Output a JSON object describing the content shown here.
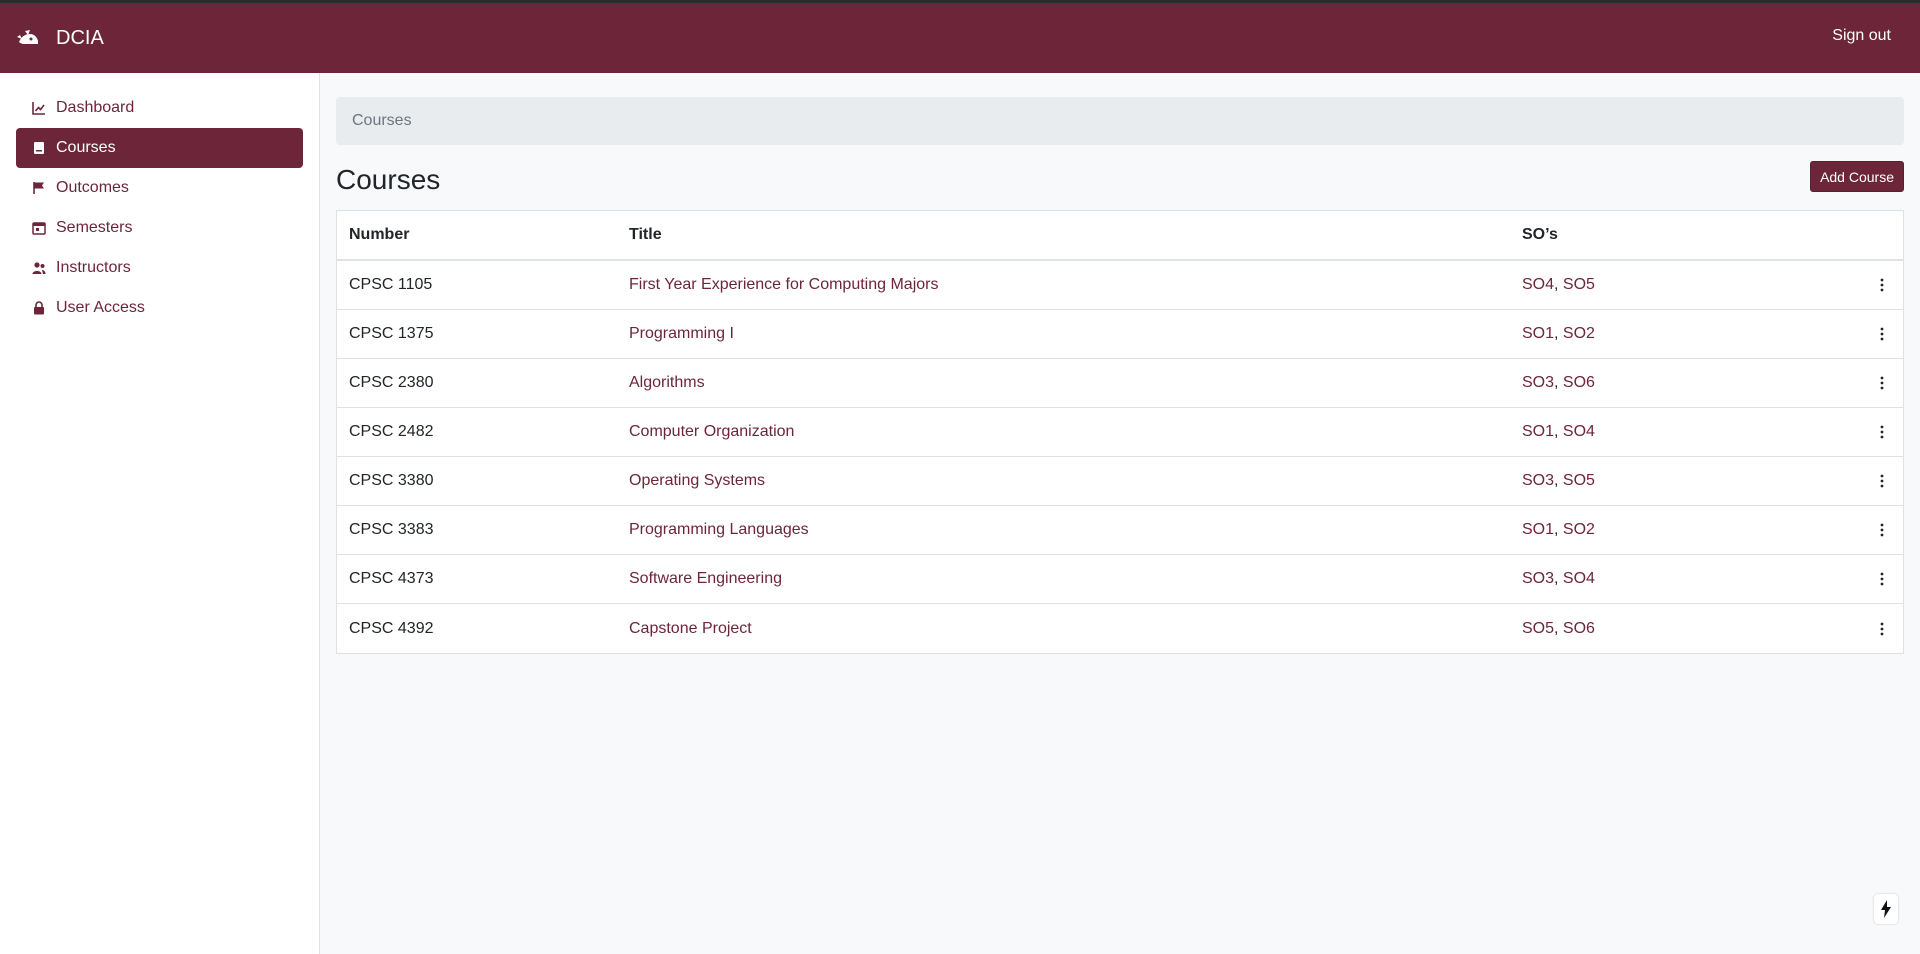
{
  "header": {
    "brand": "DCIA",
    "sign_out": "Sign out",
    "brand_color": "#6d2639"
  },
  "sidebar": {
    "items": [
      {
        "label": "Dashboard",
        "icon": "chart-line-icon",
        "active": false
      },
      {
        "label": "Courses",
        "icon": "book-icon",
        "active": true
      },
      {
        "label": "Outcomes",
        "icon": "flag-icon",
        "active": false
      },
      {
        "label": "Semesters",
        "icon": "calendar-icon",
        "active": false
      },
      {
        "label": "Instructors",
        "icon": "users-icon",
        "active": false
      },
      {
        "label": "User Access",
        "icon": "lock-icon",
        "active": false
      }
    ]
  },
  "breadcrumb": "Courses",
  "page": {
    "title": "Courses",
    "add_button": "Add Course"
  },
  "table": {
    "headers": {
      "number": "Number",
      "title": "Title",
      "sos": "SO’s"
    },
    "rows": [
      {
        "number": "CPSC 1105",
        "title": "First Year Experience for Computing Majors",
        "so1": "SO4",
        "so2": "SO5"
      },
      {
        "number": "CPSC 1375",
        "title": "Programming I",
        "so1": "SO1",
        "so2": "SO2"
      },
      {
        "number": "CPSC 2380",
        "title": "Algorithms",
        "so1": "SO3",
        "so2": "SO6"
      },
      {
        "number": "CPSC 2482",
        "title": "Computer Organization",
        "so1": "SO1",
        "so2": "SO4"
      },
      {
        "number": "CPSC 3380",
        "title": "Operating Systems",
        "so1": "SO3",
        "so2": "SO5"
      },
      {
        "number": "CPSC 3383",
        "title": "Programming Languages",
        "so1": "SO1",
        "so2": "SO2"
      },
      {
        "number": "CPSC 4373",
        "title": "Software Engineering",
        "so1": "SO3",
        "so2": "SO4"
      },
      {
        "number": "CPSC 4392",
        "title": "Capstone Project",
        "so1": "SO5",
        "so2": "SO6"
      }
    ],
    "so_separator": ", "
  }
}
